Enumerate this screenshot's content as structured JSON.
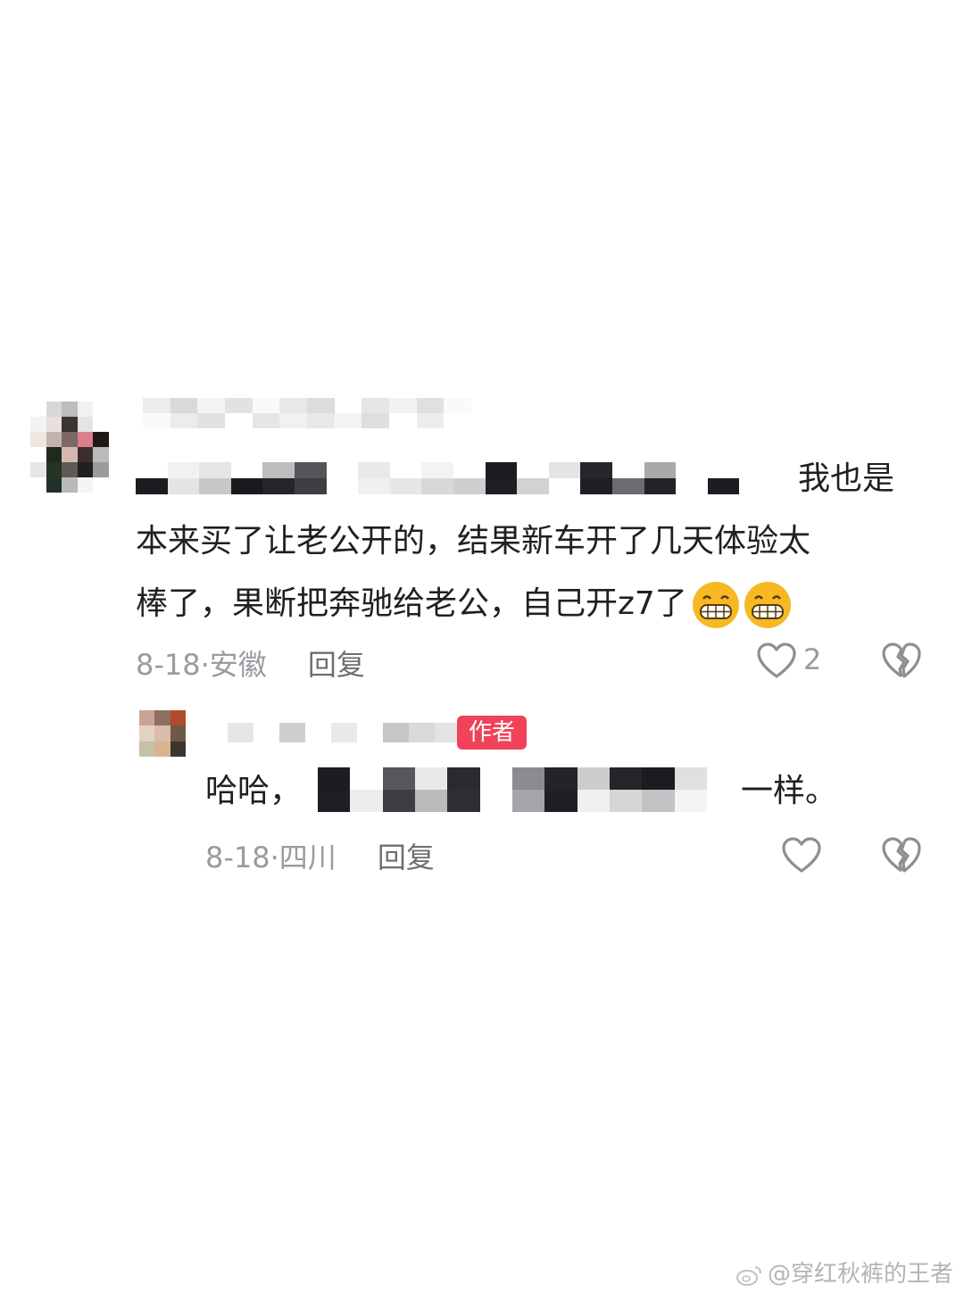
{
  "comment": {
    "line1_end": "我也是",
    "line2": "本来买了让老公开的，结果新车开了几天体验太",
    "line3": "棒了，果断把奔驰给老公，自己开z7了",
    "emoji": "grinning-face-emoji",
    "date": "8-18",
    "sep": "·",
    "location": "安徽",
    "reply_label": "回复",
    "like_count": "2"
  },
  "reply": {
    "author_badge": "作者",
    "text_start": "哈哈，",
    "text_end": "一样。",
    "date": "8-18",
    "sep": "·",
    "location": "四川",
    "reply_label": "回复"
  },
  "watermark": {
    "icon": "weibo-icon",
    "text": "@穿红秋裤的王者"
  },
  "colors": {
    "badge": "#f0435a",
    "meta": "#9a9aa0",
    "text": "#1f1f24"
  }
}
